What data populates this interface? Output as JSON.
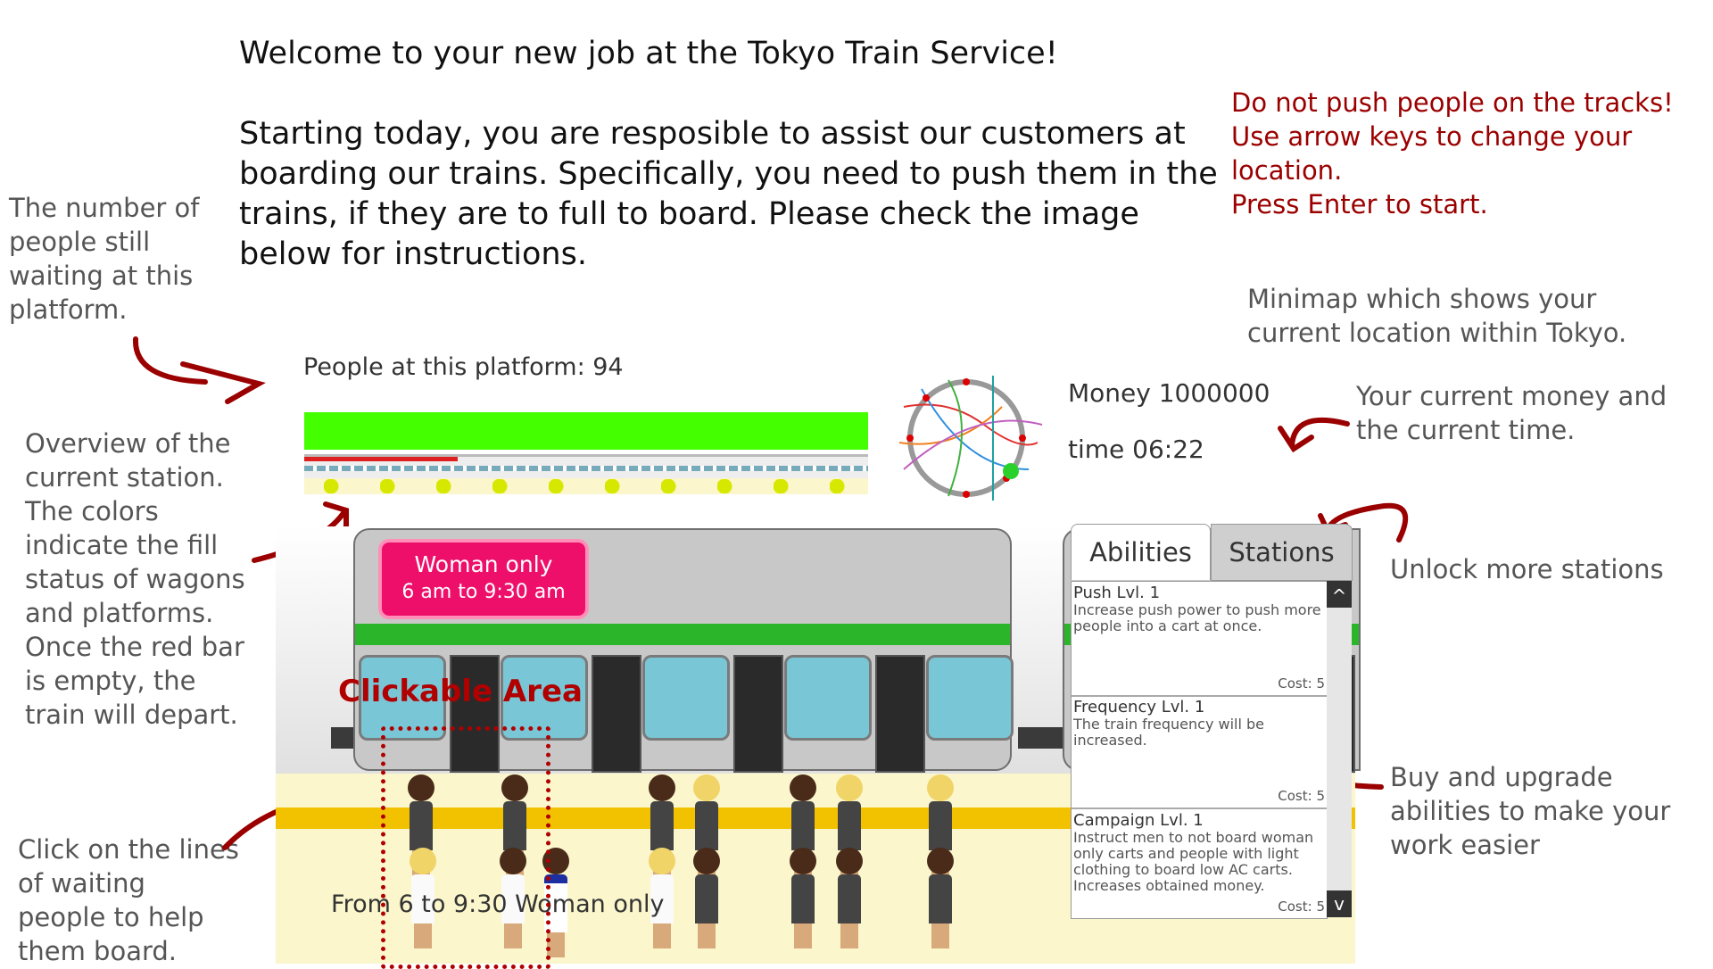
{
  "welcome": {
    "line1": "Welcome to your new job at the Tokyo Train Service!",
    "line2": "Starting today, you are resposible to assist our customers at boarding our trains. Specifically, you need to push them in the trains, if they are to full to board. Please check the image below for instructions."
  },
  "warnings": {
    "line1": "Do not push people on the tracks!",
    "line2": "Use arrow keys to change your location.",
    "line3": "Press Enter to start."
  },
  "annotations": {
    "people_count": "The number of people still waiting at this platform.",
    "overview": "Overview of the current station. The colors indicate the fill status of wagons and platforms. Once the red bar is empty, the train will depart.",
    "click_lines": "Click on the lines of waiting people to help them board.",
    "minimap": "Minimap which shows your current location within Tokyo.",
    "money_time": "Your current money and the current time.",
    "unlock": "Unlock more stations",
    "abilities": "Buy and upgrade abilities to make your work easier",
    "clickable_area": "Clickable Area"
  },
  "hud": {
    "platform_label": "People at this platform: 94",
    "money_label": "Money 1000000",
    "time_label": "time 06:22",
    "platform_sign": "From 6 to 9:30 Woman only"
  },
  "train": {
    "sign_line1": "Woman only",
    "sign_line2": "6 am to 9:30 am"
  },
  "tabs": {
    "abilities": "Abilities",
    "stations": "Stations"
  },
  "abilities": [
    {
      "name": "Push Lvl. 1",
      "desc": "Increase push power to push more people into a cart at once.",
      "cost": "Cost: 5"
    },
    {
      "name": "Frequency Lvl. 1",
      "desc": "The train frequency will be increased.",
      "cost": "Cost: 5"
    },
    {
      "name": "Campaign Lvl. 1",
      "desc": "Instruct men to not board woman only carts and people with light clothing to board low AC carts. Increases obtained money.",
      "cost": "Cost: 5"
    }
  ],
  "scroll": {
    "up": "^",
    "down": "v"
  },
  "colors": {
    "annotation_red": "#9b0000",
    "overview_green": "#44ff00",
    "sign_pink": "#ee0f6a",
    "train_stripe": "#2bb52b",
    "platform_yellow": "#f2c200"
  },
  "icons": {
    "arrow": "curved-arrow-icon",
    "minimap": "tokyo-rail-minimap-icon"
  }
}
